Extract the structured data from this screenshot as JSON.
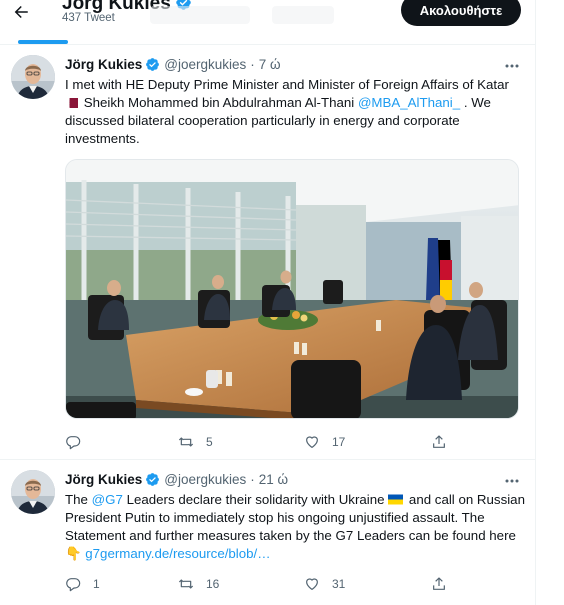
{
  "header": {
    "title": "Jörg Kukies",
    "tweet_count": "437 Tweet",
    "follow_label": "Ακολουθήστε"
  },
  "colors": {
    "accent": "#1d9bf0",
    "text": "#0f1419",
    "muted": "#536471",
    "follow_bg": "#0f1419",
    "divider": "#eff3f4"
  },
  "icons": {
    "back": "arrow-left-icon",
    "verified": "verified-badge-icon",
    "more": "more-horizontal-icon",
    "reply": "reply-icon",
    "retweet": "retweet-icon",
    "like": "heart-icon",
    "share": "share-icon"
  },
  "tweets": [
    {
      "name": "Jörg Kukies",
      "handle": "@joergkukies",
      "dot": "·",
      "time": "7 ώ",
      "text_part1": "I met with HE Deputy Prime Minister and Minister of Foreign Affairs of Katar",
      "text_part2": "Sheikh Mohammed bin Abdulrahman Al-Thani",
      "mention": "@MBA_AlThani_",
      "text_part3": ". We discussed bilateral cooperation particularly in energy and corporate investments.",
      "flag": "qatar-flag",
      "has_photo": true,
      "counts": {
        "reply": "",
        "retweet": "5",
        "like": "17"
      }
    },
    {
      "name": "Jörg Kukies",
      "handle": "@joergkukies",
      "dot": "·",
      "time": "21 ώ",
      "text_part1": "The",
      "mention": "@G7",
      "text_part2": "Leaders declare their solidarity with Ukraine",
      "flag": "ukraine-flag",
      "text_part3": "and call on Russian President Putin to immediately stop his ongoing unjustified assault. The Statement and further measures taken by the G7 Leaders can be found here",
      "emoji": "👇",
      "link": "g7germany.de/resource/blob/…",
      "counts": {
        "reply": "1",
        "retweet": "16",
        "like": "31"
      }
    }
  ]
}
